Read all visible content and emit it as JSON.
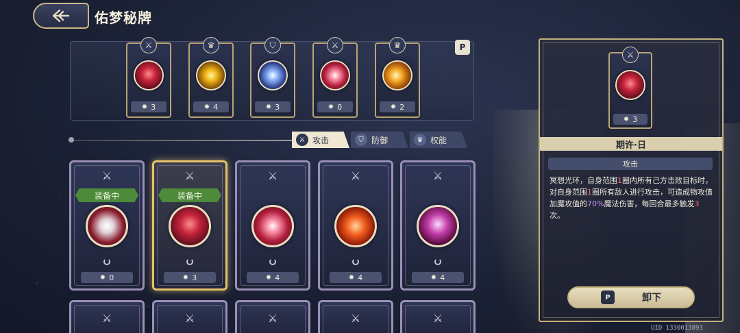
{
  "header": {
    "title": "佑梦秘牌"
  },
  "equipped_slots": [
    {
      "type_icon": "sword-icon",
      "orb": "o-red",
      "cost": "3"
    },
    {
      "type_icon": "crown-icon",
      "orb": "o-gold",
      "cost": "4"
    },
    {
      "type_icon": "shield-icon",
      "orb": "o-blue",
      "cost": "3"
    },
    {
      "type_icon": "sword-icon",
      "orb": "o-pink",
      "cost": "0"
    },
    {
      "type_icon": "crown-icon",
      "orb": "o-amber",
      "cost": "2"
    }
  ],
  "filter_tabs": [
    {
      "label": "攻击",
      "icon": "sword-icon",
      "active": true
    },
    {
      "label": "防御",
      "icon": "shield-icon",
      "active": false
    },
    {
      "label": "权能",
      "icon": "crown-icon",
      "active": false
    }
  ],
  "cards": [
    {
      "equipped_label": "装备中",
      "orb": "o-silver",
      "cost": "0",
      "selected": false
    },
    {
      "equipped_label": "装备中",
      "orb": "o-red",
      "cost": "3",
      "selected": true
    },
    {
      "equipped_label": "",
      "orb": "o-pink",
      "cost": "4",
      "selected": false
    },
    {
      "equipped_label": "",
      "orb": "o-fire",
      "cost": "4",
      "selected": false
    },
    {
      "equipped_label": "",
      "orb": "o-violet",
      "cost": "4",
      "selected": false
    }
  ],
  "detail": {
    "cost": "3",
    "name": "期许·日",
    "tag": "攻击",
    "desc_parts": [
      "冥想光环，自身范围",
      "1",
      "圈内所有己方击败目标时，对自身范围",
      "1",
      "圈所有敌人进行攻击，可造成物攻值加魔攻值的",
      "70%",
      "魔法伤害，每回合最多触发",
      "3",
      "次。"
    ],
    "button_label": "卸下"
  },
  "uid": "UID 1330013893",
  "colors": {
    "equipped_green": "#4d8a3a",
    "selected_gold": "#e6c36a",
    "highlight_red": "#ff6a6a",
    "highlight_purple": "#c590ff"
  }
}
